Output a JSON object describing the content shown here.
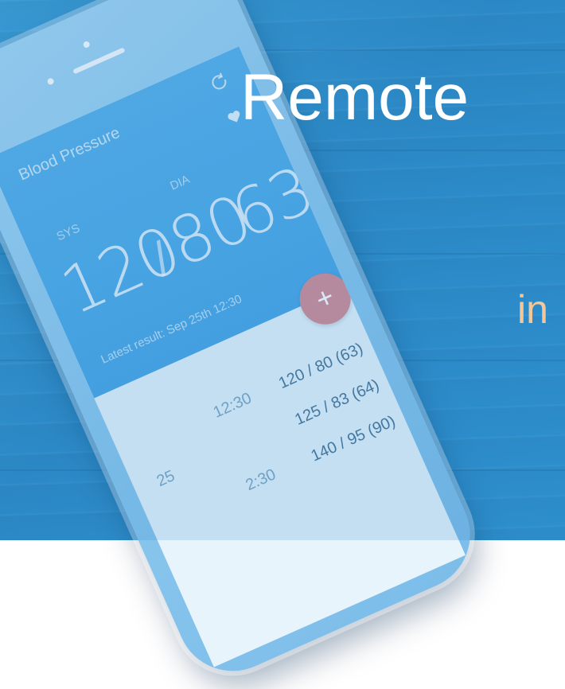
{
  "headline": {
    "title": "Remote",
    "subtitle": "in"
  },
  "app": {
    "screen_title": "Blood Pressure",
    "sys_label": "SYS",
    "dia_label": "DIA",
    "sys_value": "120",
    "dia_value": "80",
    "pulse_value": "63",
    "latest_result": "Latest result: Sep 25th 12:30",
    "add_label": "+",
    "readings": [
      {
        "date": "",
        "time": "12:30",
        "value": "120 / 80 (63)"
      },
      {
        "date": "25",
        "time": "",
        "value": "125 / 83 (64)"
      },
      {
        "date": "",
        "time": "2:30",
        "value": "140 / 95 (90)"
      }
    ]
  },
  "colors": {
    "background": "#2e8cc7",
    "screen_header": "#4aa7e6",
    "add_button": "#d58c95",
    "title_text": "#ffffff",
    "subtitle_text": "#f3c79a"
  },
  "icons": {
    "refresh": "refresh-icon",
    "heart": "heart-icon",
    "add": "plus-icon"
  }
}
